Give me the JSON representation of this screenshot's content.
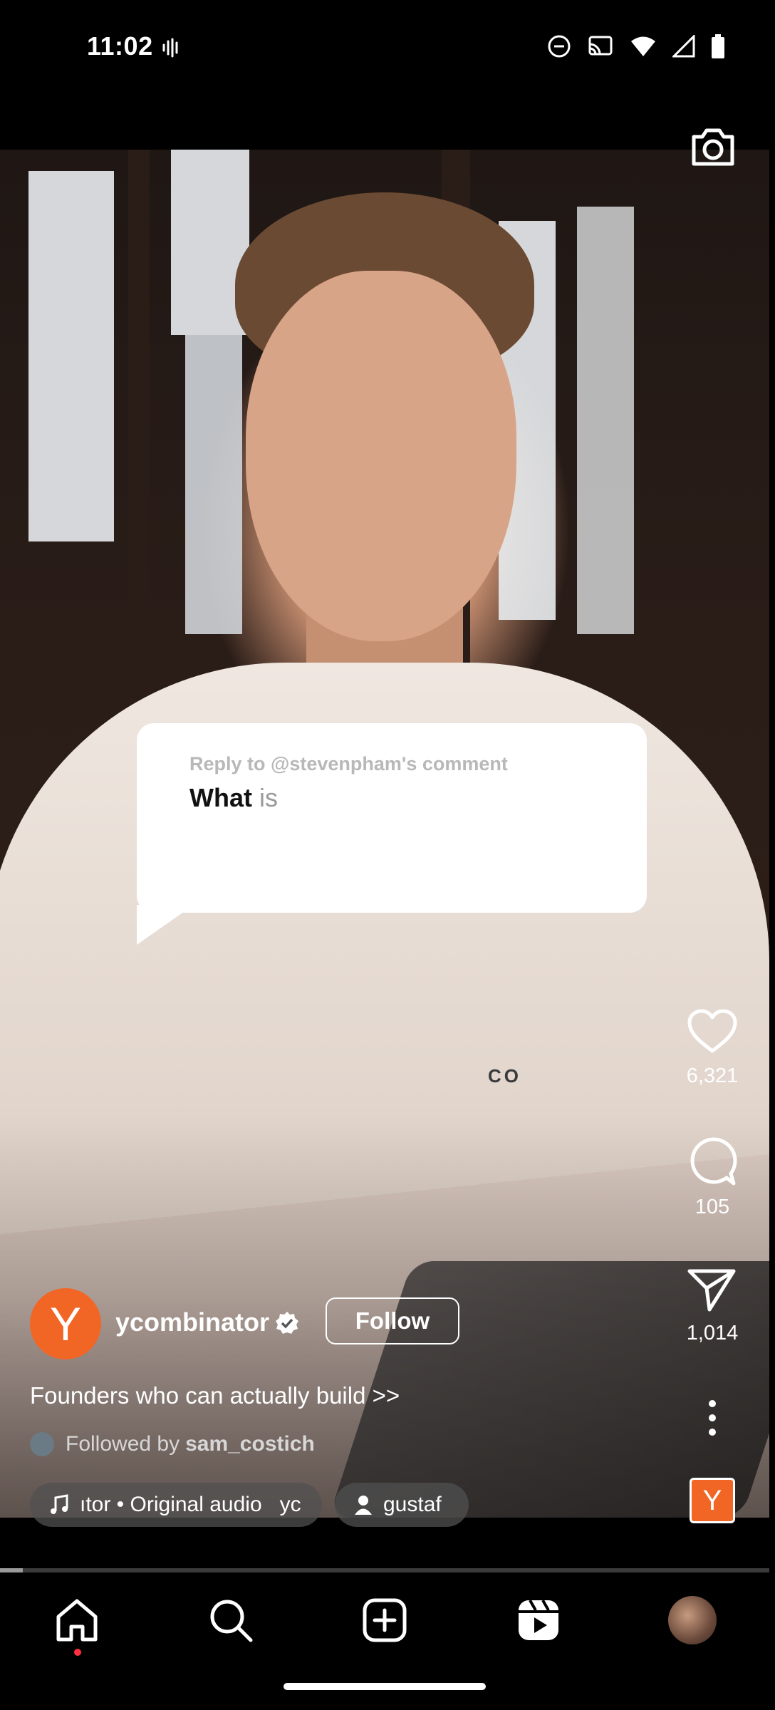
{
  "status_bar": {
    "time": "11:02"
  },
  "video": {
    "shirt_text": "co"
  },
  "comment_sticker": {
    "reply_to": "Reply to @stevenpham's comment",
    "text_typed": "What",
    "text_suggested": "is"
  },
  "actions": {
    "likes": "6,321",
    "comments": "105",
    "shares": "1,014"
  },
  "author": {
    "avatar_letter": "Y",
    "handle": "ycombinator",
    "follow_label": "Follow",
    "caption": "Founders who can actually build >>",
    "followed_by_prefix": "Followed by",
    "followed_by_user": "sam_costich"
  },
  "chips": {
    "audio": "ıtor • Original audio   yc",
    "tagged_user": "gustaf"
  },
  "audio_avatar_letter": "Y",
  "progress": 0.03,
  "colors": {
    "brand_orange": "#f26625",
    "notification_dot": "#ff3040"
  },
  "icons": {
    "camera": "camera-icon",
    "like": "heart-icon",
    "comment": "comment-icon",
    "share": "send-icon",
    "more": "more-vertical-icon",
    "home": "home-icon",
    "search": "search-icon",
    "create": "plus-square-icon",
    "reels": "reels-icon"
  }
}
